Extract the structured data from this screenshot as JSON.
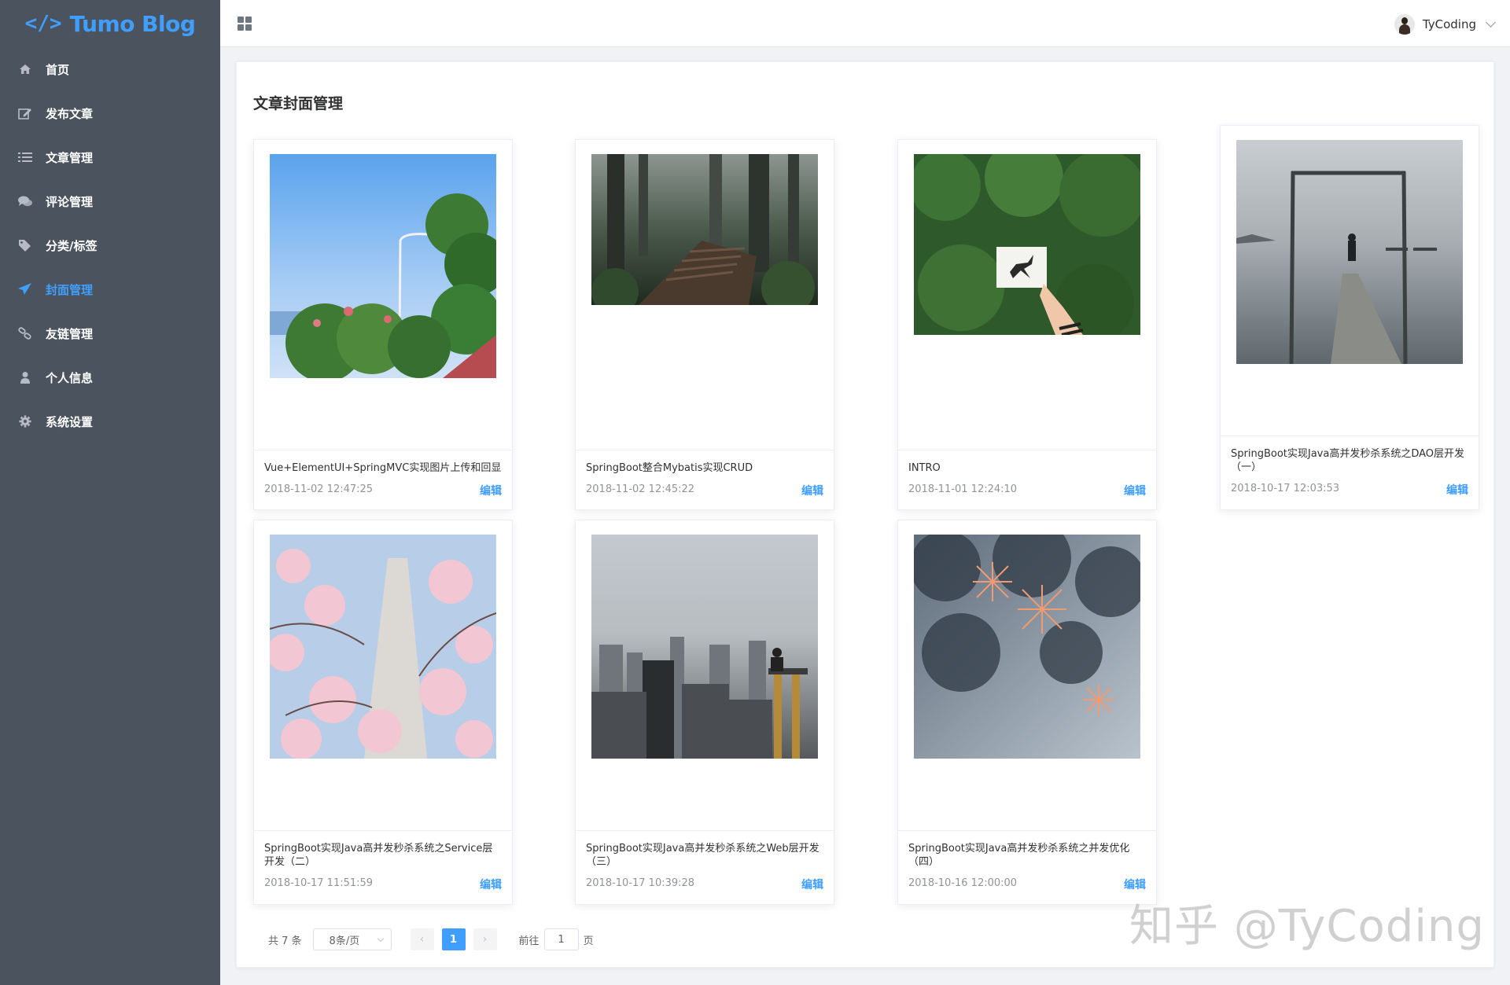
{
  "app": {
    "logo_icon": "</>",
    "title": "Tumo Blog"
  },
  "sidebar": {
    "items": [
      {
        "label": "首页",
        "icon": "home-icon",
        "active": false
      },
      {
        "label": "发布文章",
        "icon": "edit-icon",
        "active": false
      },
      {
        "label": "文章管理",
        "icon": "list-icon",
        "active": false
      },
      {
        "label": "评论管理",
        "icon": "comments-icon",
        "active": false
      },
      {
        "label": "分类/标签",
        "icon": "tags-icon",
        "active": false
      },
      {
        "label": "封面管理",
        "icon": "send-icon",
        "active": true
      },
      {
        "label": "友链管理",
        "icon": "link-icon",
        "active": false
      },
      {
        "label": "个人信息",
        "icon": "user-icon",
        "active": false
      },
      {
        "label": "系统设置",
        "icon": "gear-icon",
        "active": false
      }
    ]
  },
  "header": {
    "user_name": "TyCoding"
  },
  "page": {
    "title": "文章封面管理"
  },
  "cards": [
    {
      "title": "Vue+ElementUI+SpringMVC实现图片上传和回显",
      "date": "2018-11-02 12:47:25",
      "edit_label": "编辑"
    },
    {
      "title": "SpringBoot整合Mybatis实现CRUD",
      "date": "2018-11-02 12:45:22",
      "edit_label": "编辑"
    },
    {
      "title": "INTRO",
      "date": "2018-11-01 12:24:10",
      "edit_label": "编辑"
    },
    {
      "title": "SpringBoot实现Java高并发秒杀系统之DAO层开发（一）",
      "date": "2018-10-17 12:03:53",
      "edit_label": "编辑"
    },
    {
      "title": "SpringBoot实现Java高并发秒杀系统之Service层开发（二）",
      "date": "2018-10-17 11:51:59",
      "edit_label": "编辑"
    },
    {
      "title": "SpringBoot实现Java高并发秒杀系统之Web层开发（三）",
      "date": "2018-10-17 10:39:28",
      "edit_label": "编辑"
    },
    {
      "title": "SpringBoot实现Java高并发秒杀系统之并发优化（四）",
      "date": "2018-10-16 12:00:00",
      "edit_label": "编辑"
    }
  ],
  "pagination": {
    "total_text": "共 7 条",
    "page_size": "8条/页",
    "prev": "‹",
    "current_page": "1",
    "next": "›",
    "jump_label": "前往",
    "jump_value": "1",
    "jump_suffix": "页"
  },
  "watermark": "知乎 @TyCoding",
  "colors": {
    "accent": "#409eff",
    "sidebar_bg": "#4b535f"
  }
}
